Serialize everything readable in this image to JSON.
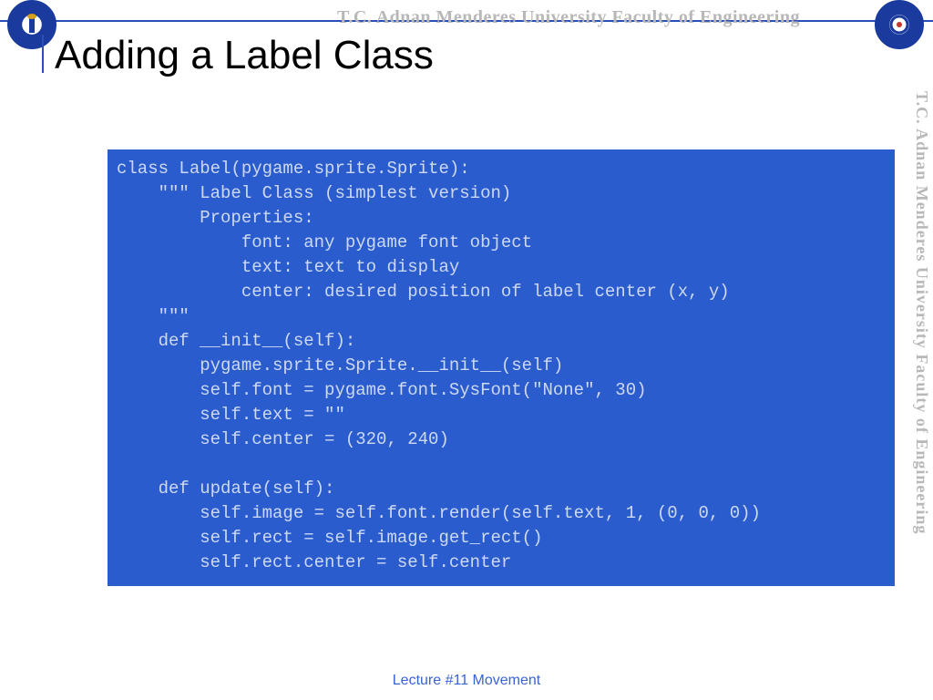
{
  "header": {
    "watermark": "T.C.    Adnan Menderes University    Faculty of Engineering",
    "title": "Adding a Label Class"
  },
  "side_watermark": "T.C.    Adnan Menderes University    Faculty of Engineering",
  "code": "class Label(pygame.sprite.Sprite):\n    \"\"\" Label Class (simplest version)\n        Properties:\n            font: any pygame font object\n            text: text to display\n            center: desired position of label center (x, y)\n    \"\"\"\n    def __init__(self):\n        pygame.sprite.Sprite.__init__(self)\n        self.font = pygame.font.SysFont(\"None\", 30)\n        self.text = \"\"\n        self.center = (320, 240)\n\n    def update(self):\n        self.image = self.font.render(self.text, 1, (0, 0, 0))\n        self.rect = self.image.get_rect()\n        self.rect.center = self.center",
  "footer": "Lecture #11 Movement"
}
